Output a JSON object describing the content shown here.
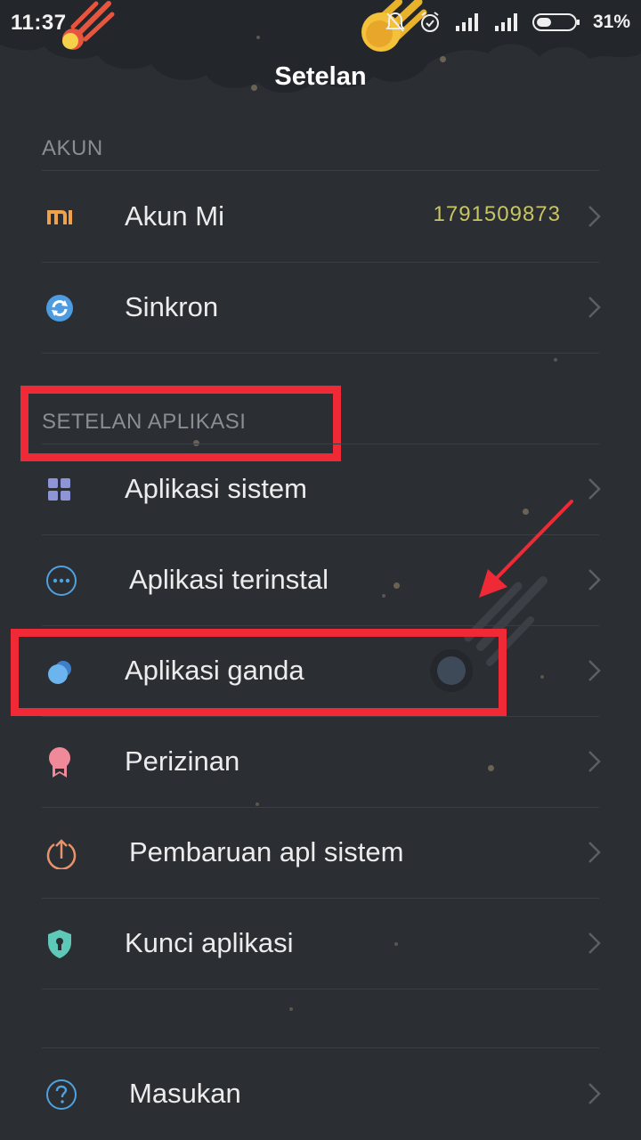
{
  "status_bar": {
    "time": "11:37",
    "battery": "31%"
  },
  "header": {
    "title": "Setelan"
  },
  "sections": {
    "akun": "AKUN",
    "setelan_aplikasi": "SETELAN APLIKASI"
  },
  "items": [
    {
      "label": "Akun Mi",
      "value": "1791509873",
      "icon": "mi-logo-icon"
    },
    {
      "label": "Sinkron",
      "icon": "sync-icon"
    },
    {
      "label": "Aplikasi sistem",
      "icon": "grid-apps-icon"
    },
    {
      "label": "Aplikasi terinstal",
      "icon": "more-dots-icon"
    },
    {
      "label": "Aplikasi ganda",
      "icon": "dual-apps-icon"
    },
    {
      "label": "Perizinan",
      "icon": "badge-icon"
    },
    {
      "label": "Pembaruan apl sistem",
      "icon": "upload-arrow-icon"
    },
    {
      "label": "Kunci aplikasi",
      "icon": "shield-lock-icon"
    },
    {
      "label": "Masukan",
      "icon": "question-icon"
    }
  ],
  "colors": {
    "background": "#2b2e33",
    "highlight": "#ef2a36",
    "value": "#c8c463",
    "mi_orange": "#f0a24a",
    "sync_blue": "#4d9be0"
  }
}
